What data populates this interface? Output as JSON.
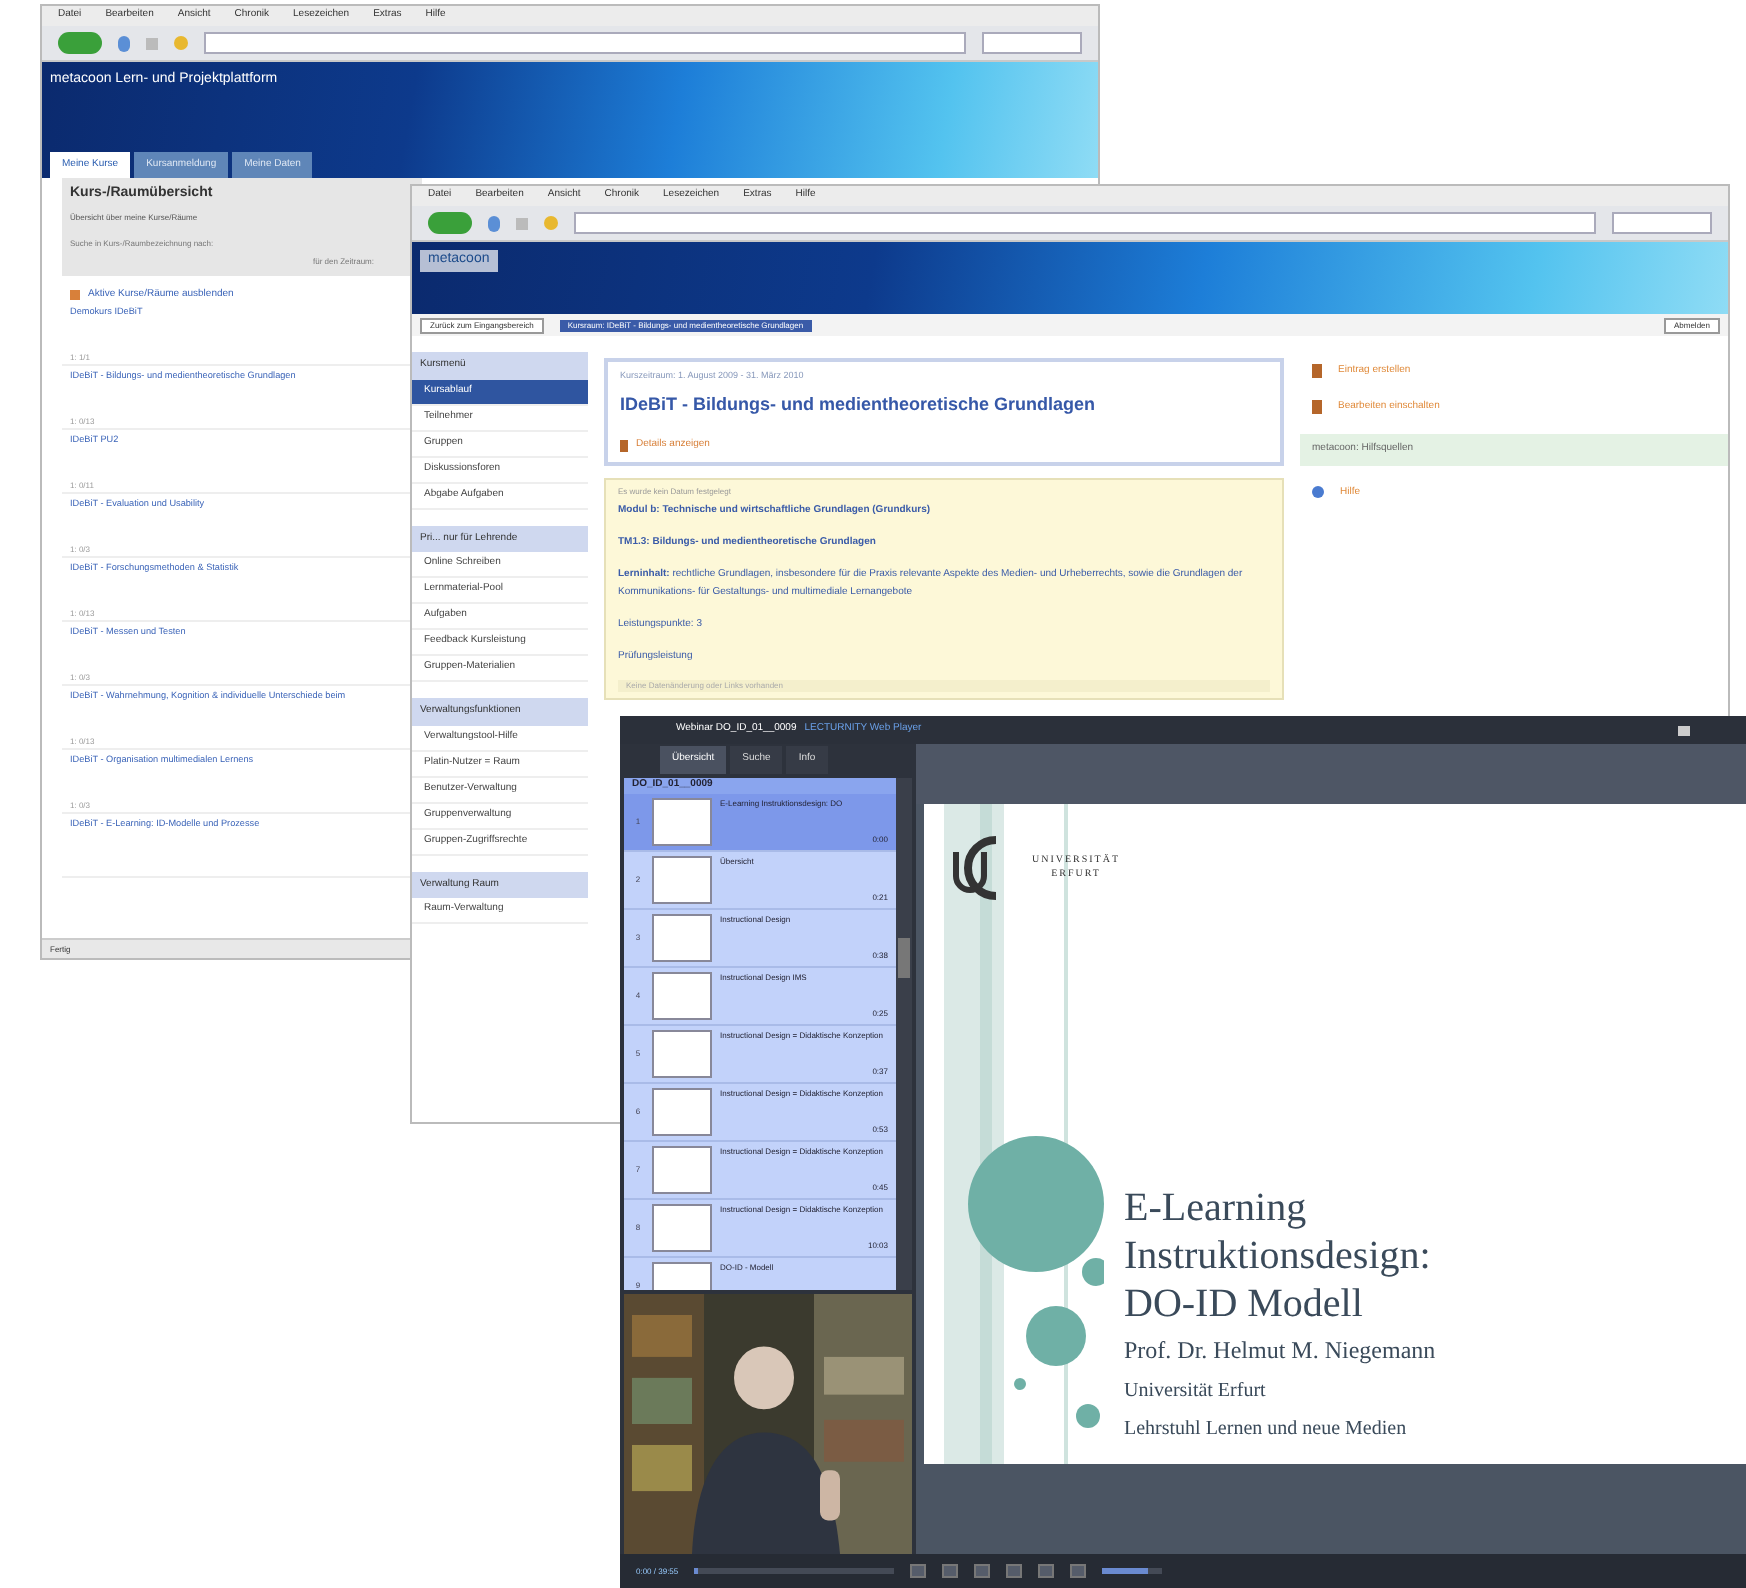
{
  "portal_window": {
    "menu": [
      "Datei",
      "Bearbeiten",
      "Ansicht",
      "Chronik",
      "Lesezeichen",
      "Extras",
      "Hilfe"
    ],
    "banner_title": "metacoon Lern- und Projektplattform",
    "tabs": [
      {
        "label": "Meine Kurse",
        "selected": true
      },
      {
        "label": "Kursanmeldung",
        "selected": false
      },
      {
        "label": "Meine Daten",
        "selected": false
      }
    ],
    "heading": "Kurs-/Raumübersicht",
    "subheading": "Übersicht über meine Kurse/Räume",
    "search_label": "Suche in Kurs-/Raumbezeichnung nach:",
    "period_label": "für den Zeitraum:",
    "hide_link": "Aktive Kurse/Räume ausblenden",
    "courses": [
      {
        "name": "Demokurs IDeBiT",
        "meta": "1: 1/1"
      },
      {
        "name": "IDeBiT - Bildungs- und medientheoretische Grundlagen",
        "meta": "1: 0/13"
      },
      {
        "name": "IDeBiT PU2",
        "meta": "1: 0/11"
      },
      {
        "name": "IDeBiT - Evaluation und Usability",
        "meta": "1: 0/3"
      },
      {
        "name": "IDeBiT - Forschungsmethoden & Statistik",
        "meta": "1: 0/13"
      },
      {
        "name": "IDeBiT - Messen und Testen",
        "meta": "1: 0/3"
      },
      {
        "name": "IDeBiT - Wahrnehmung, Kognition & individuelle Unterschiede beim",
        "meta": "1: 0/13"
      },
      {
        "name": "IDeBiT - Organisation multimedialen Lernens",
        "meta": "1: 0/3"
      },
      {
        "name": "IDeBiT - E-Learning: ID-Modelle und Prozesse"
      }
    ],
    "status_bar": "Fertig"
  },
  "course_window": {
    "menu": [
      "Datei",
      "Bearbeiten",
      "Ansicht",
      "Chronik",
      "Lesezeichen",
      "Extras",
      "Hilfe"
    ],
    "logo": "metacoon",
    "back_select": "Zurück zum Eingangsbereich",
    "breadcrumb": "Kursraum: IDeBiT - Bildungs- und medientheoretische Grundlagen",
    "logout": "Abmelden",
    "sidebar": [
      {
        "title": "Kursmenü",
        "items": [
          {
            "label": "Kursablauf",
            "selected": true
          },
          {
            "label": "Teilnehmer",
            "selected": false
          },
          {
            "label": "Gruppen",
            "selected": false
          },
          {
            "label": "Diskussionsforen",
            "selected": false
          },
          {
            "label": "Abgabe Aufgaben",
            "selected": false
          }
        ]
      },
      {
        "title": "Pri... nur für Lehrende",
        "items": [
          {
            "label": "Online Schreiben",
            "selected": false
          },
          {
            "label": "Lernmaterial-Pool",
            "selected": false
          },
          {
            "label": "Aufgaben",
            "selected": false
          },
          {
            "label": "Feedback Kursleistung",
            "selected": false
          },
          {
            "label": "Gruppen-Materialien",
            "selected": false
          }
        ]
      },
      {
        "title": "Verwaltungsfunktionen",
        "items": [
          {
            "label": "Verwaltungstool-Hilfe",
            "selected": false
          },
          {
            "label": "Platin-Nutzer = Raum",
            "selected": false
          },
          {
            "label": "Benutzer-Verwaltung",
            "selected": false
          },
          {
            "label": "Gruppenverwaltung",
            "selected": false
          },
          {
            "label": "Gruppen-Zugriffsrechte",
            "selected": false
          }
        ]
      },
      {
        "title": "Verwaltung Raum",
        "items": [
          {
            "label": "Raum-Verwaltung",
            "selected": false
          }
        ]
      }
    ],
    "period": "Kurszeitraum: 1. August 2009 - 31. März 2010",
    "title": "IDeBiT - Bildungs- und medientheoretische Grundlagen",
    "details_link": "Details anzeigen",
    "info_note": "Es wurde kein Datum festgelegt",
    "info_lines": [
      "Modul b: Technische und wirtschaftliche Grundlagen (Grundkurs)",
      "TM1.3: Bildungs- und medientheoretische Grundlagen",
      "**Lerninhalt:** rechtliche Grundlagen, insbesondere für die Praxis relevante Aspekte des Medien- und Urheberrechts, sowie die Grundlagen der Kommunikations- für Gestaltungs- und multimediale Lernangebote",
      "Leistungspunkte: 3",
      "Prüfungsleistung"
    ],
    "info_footer": "Keine Datenänderung oder Links vorhanden",
    "actions": [
      "Eintrag erstellen",
      "Bearbeiten einschalten"
    ],
    "help_title": "metacoon: Hilfsquellen",
    "help_link": "Hilfe"
  },
  "player_window": {
    "title": "Webinar DO_ID_01__0009",
    "subtitle": "LECTURNITY Web Player",
    "tabs": [
      {
        "label": "Übersicht",
        "selected": true
      },
      {
        "label": "Suche",
        "selected": false
      },
      {
        "label": "Info",
        "selected": false
      }
    ],
    "list_title": "DO_ID_01__0009",
    "slides": [
      {
        "number": "1",
        "title": "E-Learning Instruktionsdesign: DO",
        "time": "0:00",
        "selected": true
      },
      {
        "number": "2",
        "title": "Übersicht",
        "time": "0:21",
        "selected": false
      },
      {
        "number": "3",
        "title": "Instructional Design",
        "time": "0:38",
        "selected": false
      },
      {
        "number": "4",
        "title": "Instructional Design IMS",
        "time": "0:25",
        "selected": false
      },
      {
        "number": "5",
        "title": "Instructional Design = Didaktische Konzeption",
        "time": "0:37",
        "selected": false
      },
      {
        "number": "6",
        "title": "Instructional Design = Didaktische Konzeption",
        "time": "0:53",
        "selected": false
      },
      {
        "number": "7",
        "title": "Instructional Design = Didaktische Konzeption",
        "time": "0:45",
        "selected": false
      },
      {
        "number": "8",
        "title": "Instructional Design = Didaktische Konzeption",
        "time": "10:03",
        "selected": false
      },
      {
        "number": "9",
        "title": "DO-ID - Modell",
        "selected": false
      }
    ],
    "slide": {
      "logo_text": "UNIVERSITÄT ERFURT",
      "title_lines": [
        "E-Learning",
        "Instruktionsdesign:",
        "DO-ID Modell"
      ],
      "author": "Prof. Dr. Helmut M. Niegemann",
      "lines": [
        "Universität Erfurt",
        "Lehrstuhl Lernen und neue Medien"
      ]
    },
    "time": "0:00 / 39:55",
    "position": {
      "level": 0.02
    },
    "volume": {
      "level": 0.75
    }
  }
}
